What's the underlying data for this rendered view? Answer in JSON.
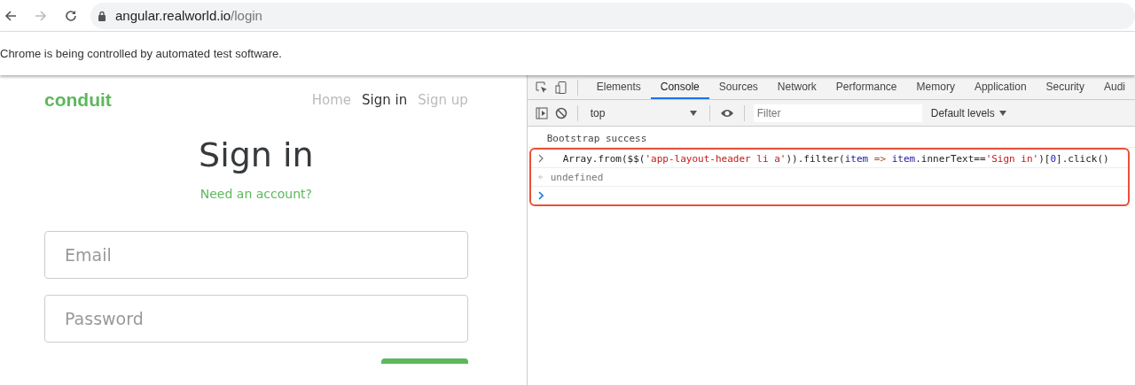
{
  "browser": {
    "url_host": "angular.realworld.io",
    "url_path": "/login",
    "infobar": "Chrome is being controlled by automated test software."
  },
  "app": {
    "brand": "conduit",
    "nav": [
      {
        "label": "Home",
        "selected": false
      },
      {
        "label": "Sign in",
        "selected": true
      },
      {
        "label": "Sign up",
        "selected": false
      }
    ],
    "title": "Sign in",
    "link": "Need an account?",
    "fields": [
      {
        "placeholder": "Email"
      },
      {
        "placeholder": "Password"
      }
    ]
  },
  "devtools": {
    "tabs": [
      {
        "label": "Elements",
        "selected": false
      },
      {
        "label": "Console",
        "selected": true
      },
      {
        "label": "Sources",
        "selected": false
      },
      {
        "label": "Network",
        "selected": false
      },
      {
        "label": "Performance",
        "selected": false
      },
      {
        "label": "Memory",
        "selected": false
      },
      {
        "label": "Application",
        "selected": false
      },
      {
        "label": "Security",
        "selected": false
      },
      {
        "label": "Audi",
        "selected": false
      }
    ],
    "context": "top",
    "filter_placeholder": "Filter",
    "levels": "Default levels",
    "messages": [
      {
        "kind": "log",
        "text": "Bootstrap success"
      },
      {
        "kind": "input",
        "highlighted": true,
        "tokens": [
          {
            "kind": "plain",
            "text": "Array.from($$("
          },
          {
            "kind": "string",
            "text": "'app-layout-header li a'"
          },
          {
            "kind": "plain",
            "text": ")).filter("
          },
          {
            "kind": "name",
            "text": "item"
          },
          {
            "kind": "operator",
            "text": " => "
          },
          {
            "kind": "name",
            "text": "item"
          },
          {
            "kind": "plain",
            "text": ".innerText=="
          },
          {
            "kind": "string",
            "text": "'Sign in'"
          },
          {
            "kind": "plain",
            "text": ")["
          },
          {
            "kind": "name",
            "text": "0"
          },
          {
            "kind": "plain",
            "text": "].click()"
          }
        ]
      },
      {
        "kind": "result",
        "highlighted": true,
        "text": "undefined"
      },
      {
        "kind": "prompt",
        "highlighted": true
      }
    ]
  }
}
